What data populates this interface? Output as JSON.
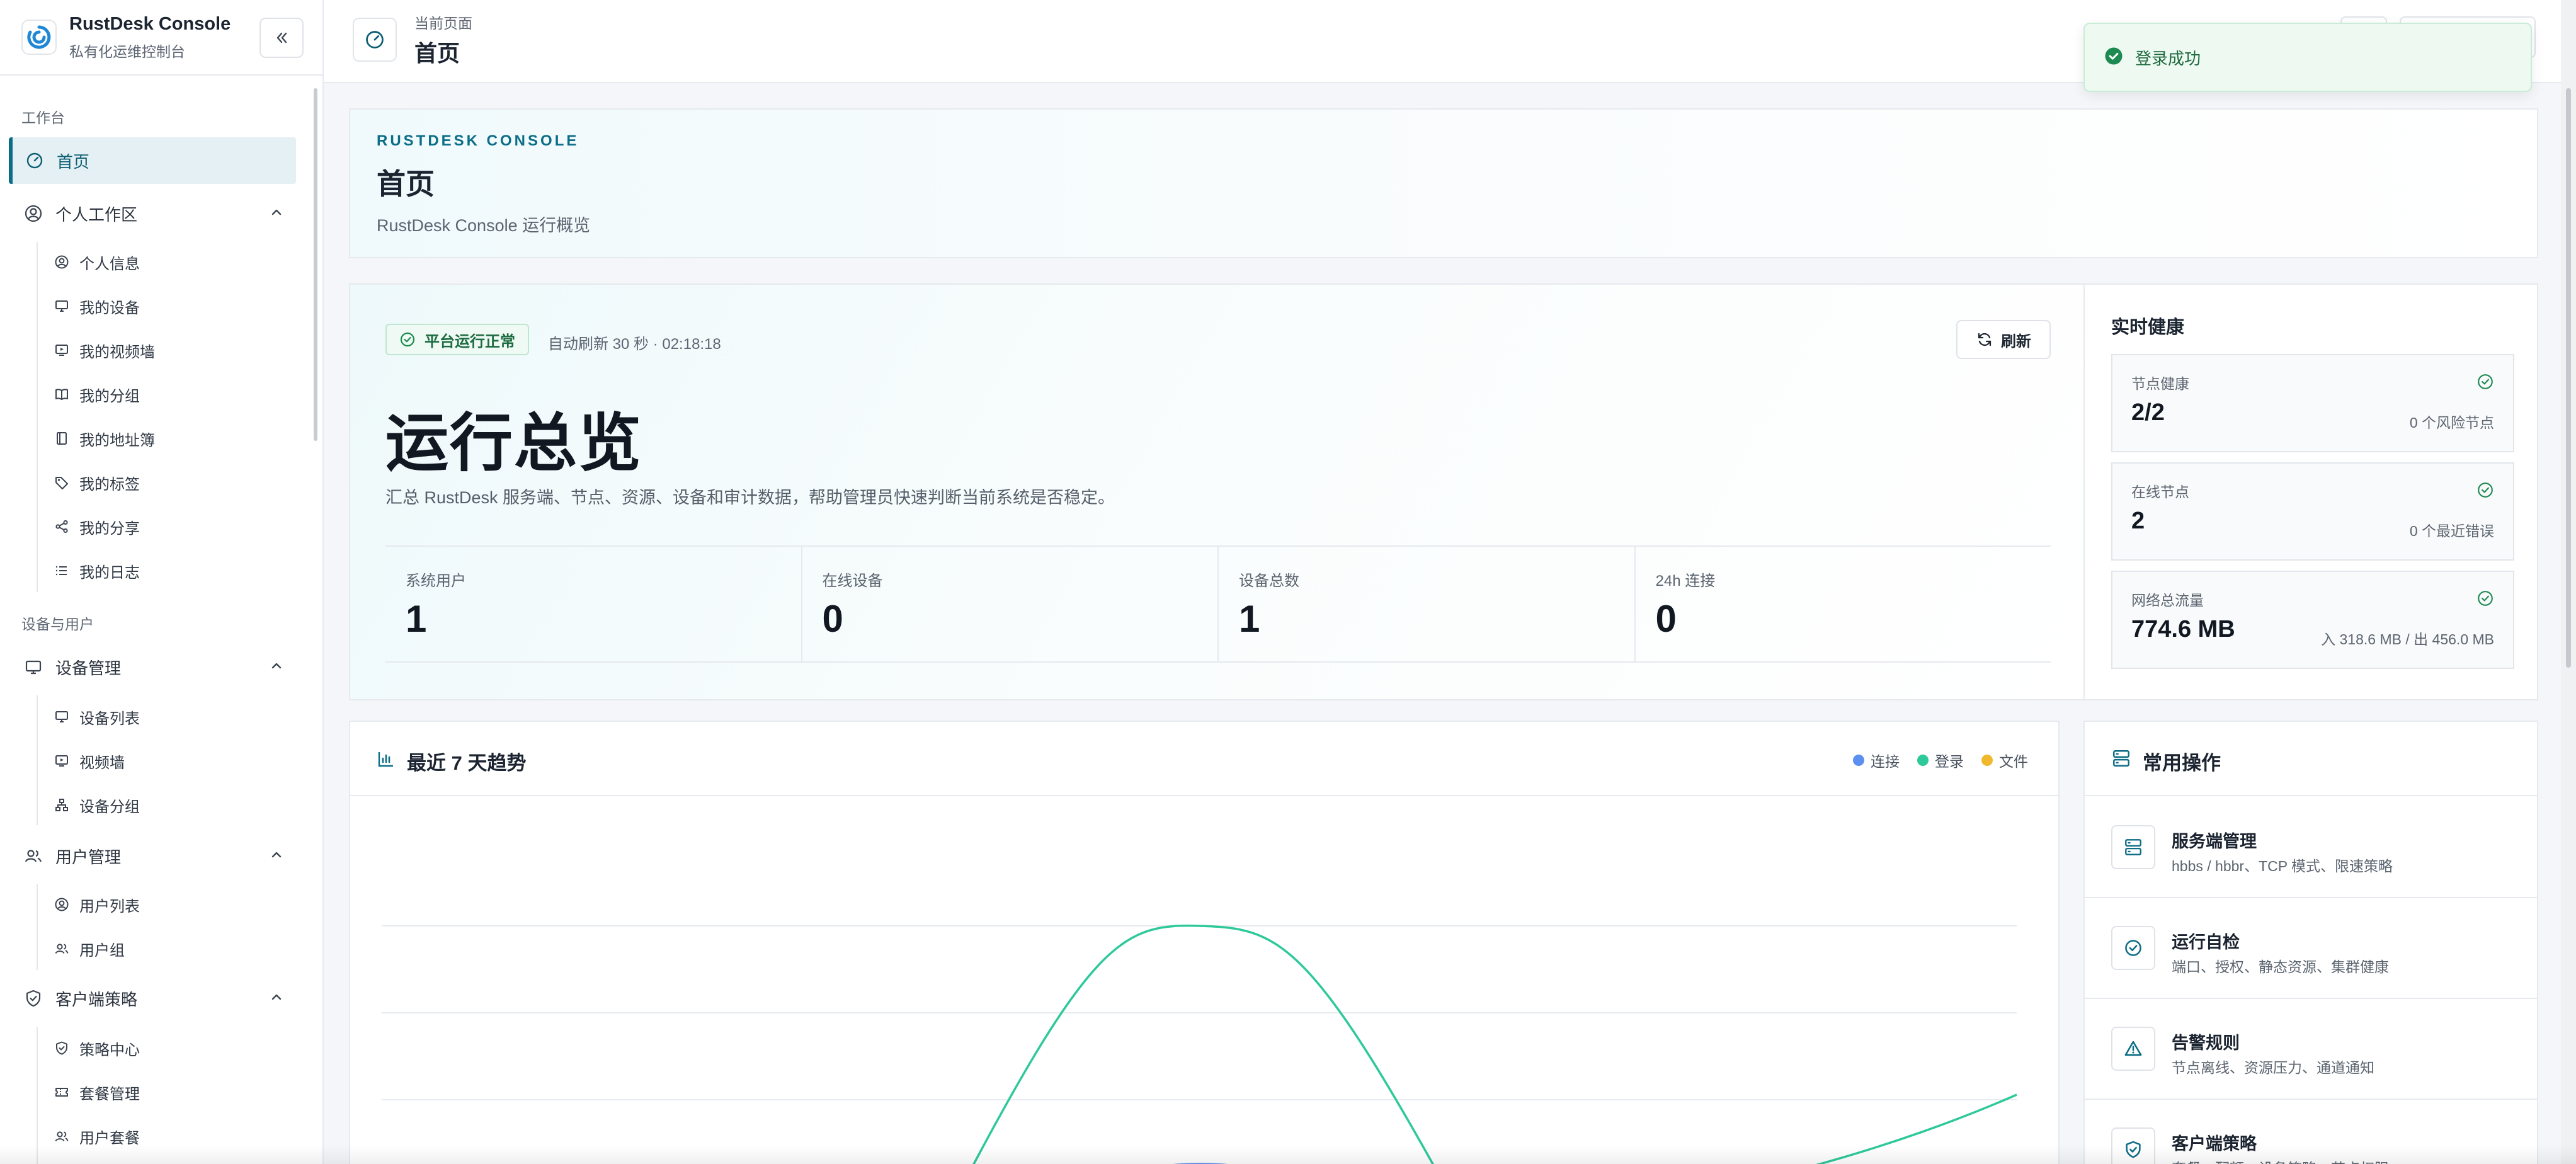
{
  "brand": {
    "title": "RustDesk Console",
    "subtitle": "私有化运维控制台"
  },
  "sidebar": {
    "section_workbench": "工作台",
    "home": "首页",
    "personal": {
      "label": "个人工作区",
      "items": [
        "个人信息",
        "我的设备",
        "我的视频墙",
        "我的分组",
        "我的地址簿",
        "我的标签",
        "我的分享",
        "我的日志"
      ]
    },
    "section_devices_users": "设备与用户",
    "device_mgmt": {
      "label": "设备管理",
      "items": [
        "设备列表",
        "视频墙",
        "设备分组"
      ]
    },
    "user_mgmt": {
      "label": "用户管理",
      "items": [
        "用户列表",
        "用户组"
      ]
    },
    "client_policy": {
      "label": "客户端策略",
      "items": [
        "策略中心",
        "套餐管理",
        "用户套餐"
      ]
    }
  },
  "header": {
    "crumb": "当前页面",
    "title": "首页"
  },
  "toast": {
    "message": "登录成功"
  },
  "hero": {
    "eyebrow": "RUSTDESK CONSOLE",
    "title": "首页",
    "description": "RustDesk Console 运行概览"
  },
  "overview": {
    "status": "平台运行正常",
    "auto_refresh": "自动刷新 30 秒 · 02:18:18",
    "refresh_label": "刷新",
    "title": "运行总览",
    "description": "汇总 RustDesk 服务端、节点、资源、设备和审计数据，帮助管理员快速判断当前系统是否稳定。",
    "stats": [
      {
        "label": "系统用户",
        "value": "1"
      },
      {
        "label": "在线设备",
        "value": "0"
      },
      {
        "label": "设备总数",
        "value": "1"
      },
      {
        "label": "24h 连接",
        "value": "0"
      }
    ]
  },
  "health": {
    "title": "实时健康",
    "cards": [
      {
        "label": "节点健康",
        "value": "2/2",
        "note": "0 个风险节点"
      },
      {
        "label": "在线节点",
        "value": "2",
        "note": "0 个最近错误"
      },
      {
        "label": "网络总流量",
        "value": "774.6 MB",
        "note": "入 318.6 MB / 出 456.0 MB"
      }
    ]
  },
  "trend": {
    "title": "最近 7 天趋势",
    "legend": [
      "连接",
      "登录",
      "文件"
    ]
  },
  "chart_data": {
    "type": "line",
    "title": "最近 7 天趋势",
    "smooth": true,
    "grid": true,
    "legend_position": "top-right",
    "series": [
      {
        "name": "连接",
        "color": "#5b8ff0"
      },
      {
        "name": "登录",
        "color": "#2ec99a"
      },
      {
        "name": "文件",
        "color": "#f0b92d"
      }
    ]
  },
  "ops": {
    "title": "常用操作",
    "items": [
      {
        "name": "服务端管理",
        "desc": "hbbs / hbbr、TCP 模式、限速策略"
      },
      {
        "name": "运行自检",
        "desc": "端口、授权、静态资源、集群健康"
      },
      {
        "name": "告警规则",
        "desc": "节点离线、资源压力、通道通知"
      },
      {
        "name": "客户端策略",
        "desc": "套餐、配额、设备策略、节点权限"
      }
    ]
  },
  "colors": {
    "accent": "#0b6d86",
    "success": "#1d6b41",
    "border": "#e6e9ee"
  }
}
